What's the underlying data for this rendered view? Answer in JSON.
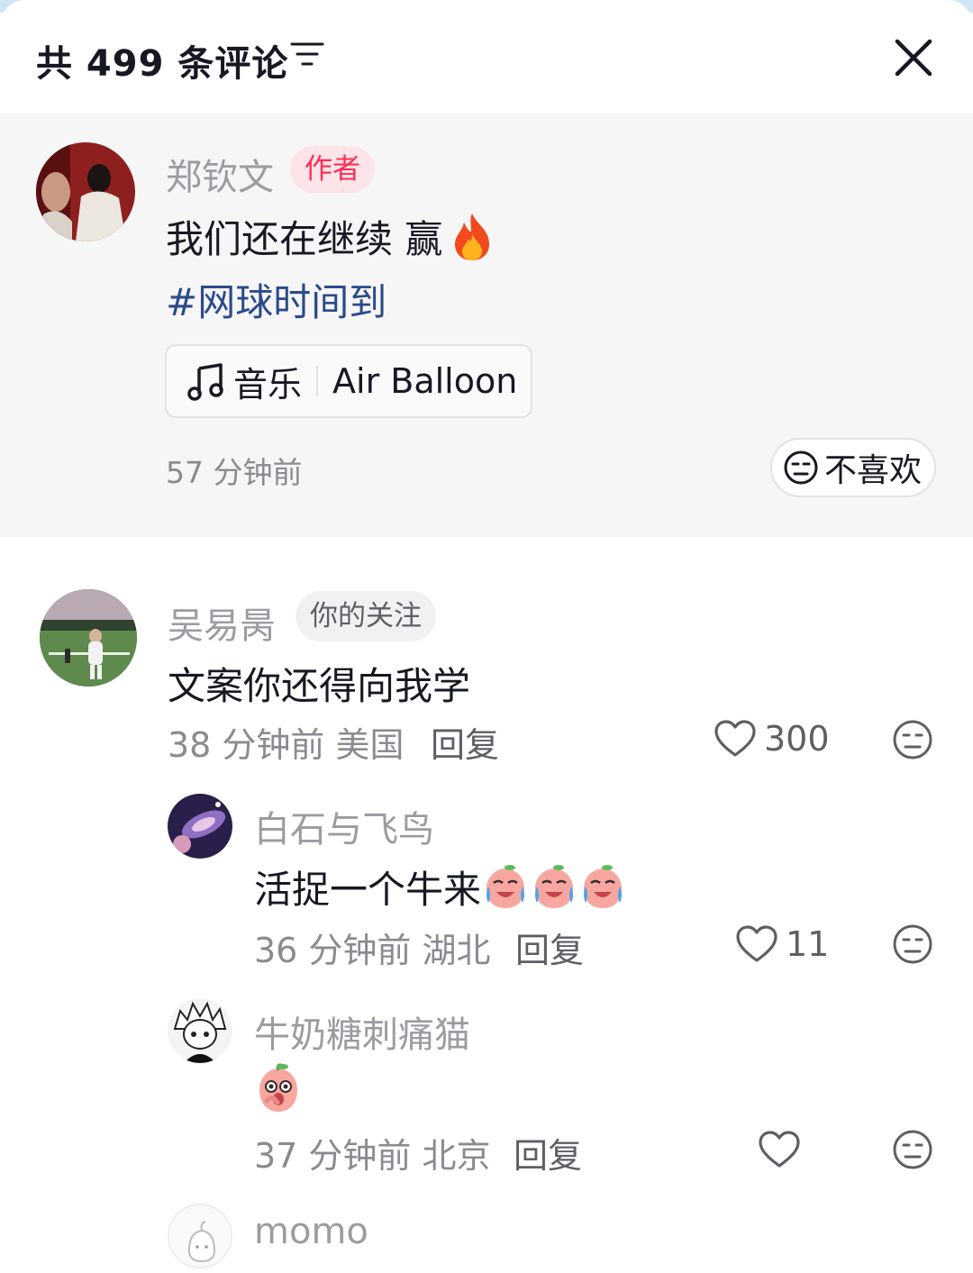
{
  "header": {
    "title": "共 499 条评论",
    "sort_icon": "filter-lines-icon",
    "close_icon": "close-icon"
  },
  "author_comment": {
    "name": "郑钦文",
    "badge": "作者",
    "text": "我们还在继续 赢",
    "text_emoji": "fire-icon",
    "hashtag": "#网球时间到",
    "music_label": "音乐",
    "music_song": "Air Balloon",
    "time": "57 分钟前",
    "dislike_label": "不喜欢"
  },
  "comments": [
    {
      "name": "吴易昺",
      "badge": "你的关注",
      "text": "文案你还得向我学",
      "meta": "38 分钟前 美国",
      "reply_label": "回复",
      "likes": "300"
    }
  ],
  "replies": [
    {
      "name": "白石与飞鸟",
      "text": "活捉一个牛来",
      "text_emoji": "crying-peach-emoji",
      "emoji_count": 3,
      "meta": "36 分钟前 湖北",
      "reply_label": "回复",
      "likes": "11"
    },
    {
      "name": "牛奶糖刺痛猫",
      "text": "",
      "text_emoji": "shocked-peach-emoji",
      "meta": "37 分钟前 北京",
      "reply_label": "回复",
      "likes": ""
    },
    {
      "name": "momo"
    }
  ],
  "colors": {
    "accent_red": "#fe2c55",
    "hashtag_blue": "#2b4a8a",
    "gray_text": "#8a8b91",
    "pinned_bg": "#f6f6f7"
  }
}
